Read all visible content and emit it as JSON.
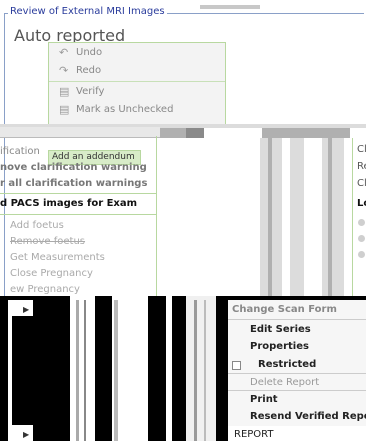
{
  "section": {
    "title": "Review of External MRI Images"
  },
  "status_title": "Auto reported",
  "context_menu_top": {
    "items": [
      {
        "label": "Undo",
        "icon": "undo-icon"
      },
      {
        "label": "Redo",
        "icon": "redo-icon"
      },
      {
        "label": "Verify",
        "icon": "verify-icon"
      },
      {
        "label": "Mark as Unchecked",
        "icon": "mark-unchecked-icon"
      }
    ]
  },
  "left_menu": {
    "items": [
      "ification",
      "nove clarification warning",
      "r all clarification warnings",
      "d PACS images for Exam",
      "Add foetus",
      "Remove foetus",
      "Get Measurements",
      "Close Pregnancy",
      "ew Pregnancy"
    ]
  },
  "tooltip": "Add an addendum",
  "right_fragments": [
    "Cl",
    "Re",
    "Cl",
    "Lo"
  ],
  "context_menu_bottom": {
    "header": "Change Scan Form",
    "items": [
      {
        "label": "Edit Series",
        "muted": false,
        "checkbox": false
      },
      {
        "label": "Properties",
        "muted": false,
        "checkbox": false
      },
      {
        "label": "Restricted",
        "muted": false,
        "checkbox": true
      },
      {
        "label": "Delete Report",
        "muted": true,
        "checkbox": false
      },
      {
        "label": "Print",
        "muted": false,
        "checkbox": false
      },
      {
        "label": "Resend Verified Report",
        "muted": false,
        "checkbox": false
      }
    ],
    "footer": "REPORT"
  },
  "colors": {
    "accent": "#2a3c9c",
    "menu_border": "#b8d8a0",
    "tooltip_bg": "#d8ecc8"
  }
}
